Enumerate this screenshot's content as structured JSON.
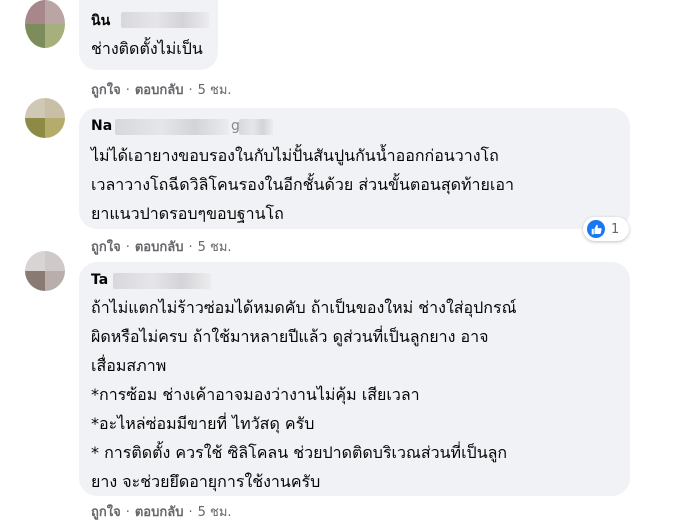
{
  "comments": [
    {
      "author": "นิน",
      "lines": [
        "ช่างติดตั้งไม่เป็น"
      ],
      "like": "ถูกใจ",
      "reply": "ตอบกลับ",
      "time": "5 ชม."
    },
    {
      "author": "Na",
      "author_tail": "g",
      "lines": [
        "ไม่ได้เอายางขอบรองในกับไม่ปั้นสันปูนกันน้ำออกก่อนวางโถ",
        "เวลาวางโถฉีดวิลิโคนรองในอีกชั้นด้วย ส่วนขั้นตอนสุดท้ายเอา",
        "ยาแนวปาดรอบๆขอบฐานโถ"
      ],
      "like": "ถูกใจ",
      "reply": "ตอบกลับ",
      "time": "5 ชม.",
      "reaction": {
        "icon": "thumbs-up-icon",
        "count": "1",
        "color": "#1877f2"
      }
    },
    {
      "author": "Ta",
      "lines": [
        "ถ้าไม่แตกไม่ร้าวซ่อมได้หมดคับ ถ้าเป็นของใหม่ ช่างใส่อุปกรณ์",
        "ผิดหรือไม่ครบ ถ้าใช้มาหลายปีแล้ว ดูส่วนที่เป็นลูกยาง อาจ",
        "เสื่อมสภาพ",
        "*การซ้อม ช่างเค้าอาจมองว่างานไม่คุ้ม เสียเวลา",
        "*อะไหล่ซ่อมมีขายที่ ไทวัสดุ ครับ",
        "* การติดตั้ง ควรใช้ ซิลิโคลน ช่วยปาดติดบริเวณส่วนที่เป็นลูก",
        "ยาง จะช่วยยึดอายุการใช้งานครับ"
      ],
      "like": "ถูกใจ",
      "reply": "ตอบกลับ",
      "time": "5 ชม."
    }
  ],
  "separator": "·"
}
